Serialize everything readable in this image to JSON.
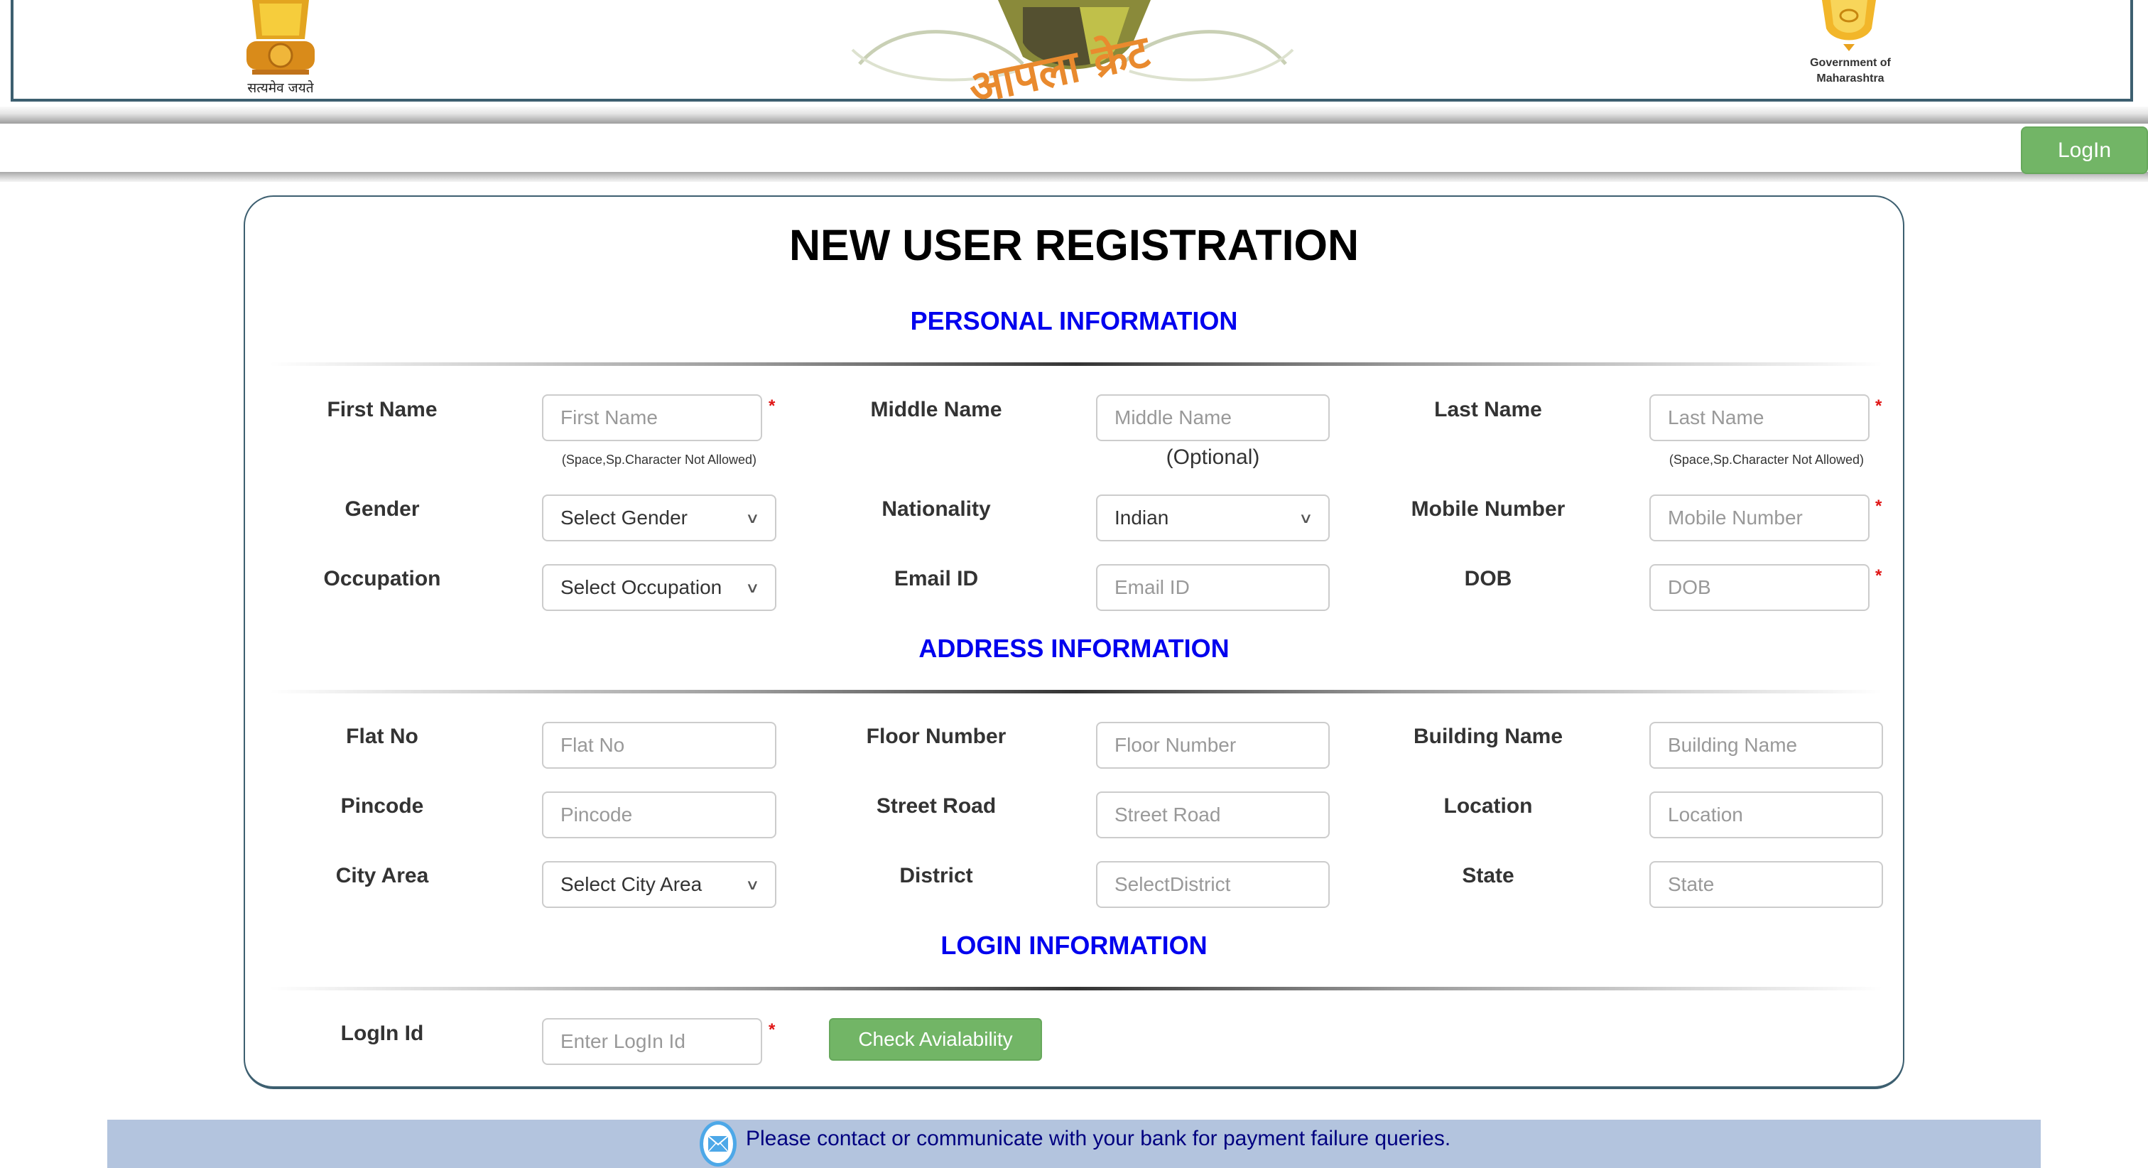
{
  "header": {
    "emblem_caption": "सत्यमेव जयते",
    "logo_text": "आपला क्रेट",
    "gov_caption_line1": "Government of",
    "gov_caption_line2": "Maharashtra",
    "login_button": "LogIn"
  },
  "form": {
    "title": "NEW USER REGISTRATION",
    "sections": {
      "personal": "PERSONAL INFORMATION",
      "address": "ADDRESS INFORMATION",
      "login": "LOGIN INFORMATION"
    },
    "required_mark": "*",
    "personal": {
      "first_name": {
        "label": "First Name",
        "placeholder": "First Name",
        "hint": "(Space,Sp.Character Not Allowed)"
      },
      "middle_name": {
        "label": "Middle Name",
        "placeholder": "Middle Name",
        "hint": "(Optional)"
      },
      "last_name": {
        "label": "Last Name",
        "placeholder": "Last Name",
        "hint": "(Space,Sp.Character Not Allowed)"
      },
      "gender": {
        "label": "Gender",
        "selected": "Select Gender"
      },
      "nationality": {
        "label": "Nationality",
        "selected": "Indian"
      },
      "mobile": {
        "label": "Mobile Number",
        "placeholder": "Mobile Number"
      },
      "occupation": {
        "label": "Occupation",
        "selected": "Select Occupation"
      },
      "email": {
        "label": "Email ID",
        "placeholder": "Email ID"
      },
      "dob": {
        "label": "DOB",
        "placeholder": "DOB"
      }
    },
    "address": {
      "flat": {
        "label": "Flat No",
        "placeholder": "Flat No"
      },
      "floor": {
        "label": "Floor Number",
        "placeholder": "Floor Number"
      },
      "building": {
        "label": "Building Name",
        "placeholder": "Building Name"
      },
      "pincode": {
        "label": "Pincode",
        "placeholder": "Pincode"
      },
      "street": {
        "label": "Street Road",
        "placeholder": "Street Road"
      },
      "location": {
        "label": "Location",
        "placeholder": "Location"
      },
      "city_area": {
        "label": "City Area",
        "selected": "Select City Area"
      },
      "district": {
        "label": "District",
        "placeholder": "SelectDistrict"
      },
      "state": {
        "label": "State",
        "placeholder": "State"
      }
    },
    "login": {
      "login_id": {
        "label": "LogIn Id",
        "placeholder": "Enter LogIn Id"
      },
      "check_button": "Check Avialability"
    }
  },
  "footer": {
    "notice": "Please contact or communicate with your bank for payment failure queries."
  },
  "colors": {
    "accent_green": "#72b566",
    "section_blue": "#0000ee",
    "border_teal": "#3d5f70",
    "footer_bg": "#b3c4de",
    "footer_text": "#000080",
    "required_red": "#e01515"
  }
}
